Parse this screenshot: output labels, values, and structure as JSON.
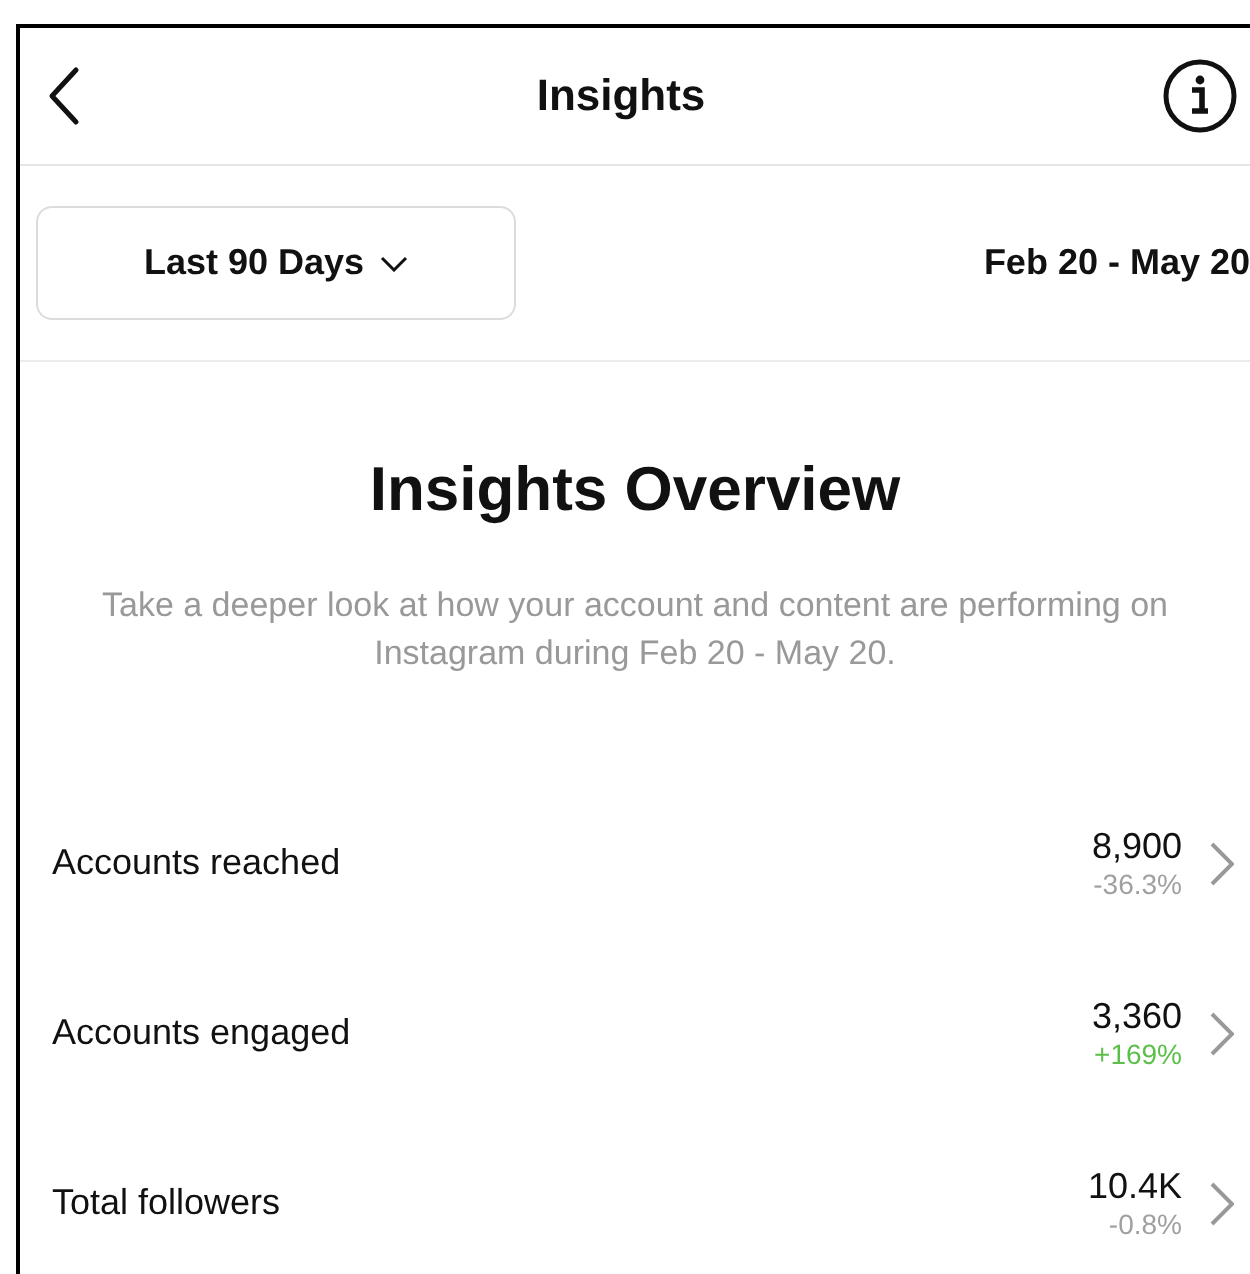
{
  "header": {
    "title": "Insights"
  },
  "filter": {
    "range": "Last 90 Days",
    "dates": "Feb 20 - May 20"
  },
  "overview": {
    "title": "Insights Overview",
    "description": "Take a deeper look at how your account and content are performing on Instagram during Feb 20 - May 20."
  },
  "metrics": [
    {
      "label": "Accounts reached",
      "value": "8,900",
      "change": "-36.3%",
      "color": "#a0a0a0"
    },
    {
      "label": "Accounts engaged",
      "value": "3,360",
      "change": "+169%",
      "color": "#5cbf4a"
    },
    {
      "label": "Total followers",
      "value": "10.4K",
      "change": "-0.8%",
      "color": "#a0a0a0"
    }
  ]
}
